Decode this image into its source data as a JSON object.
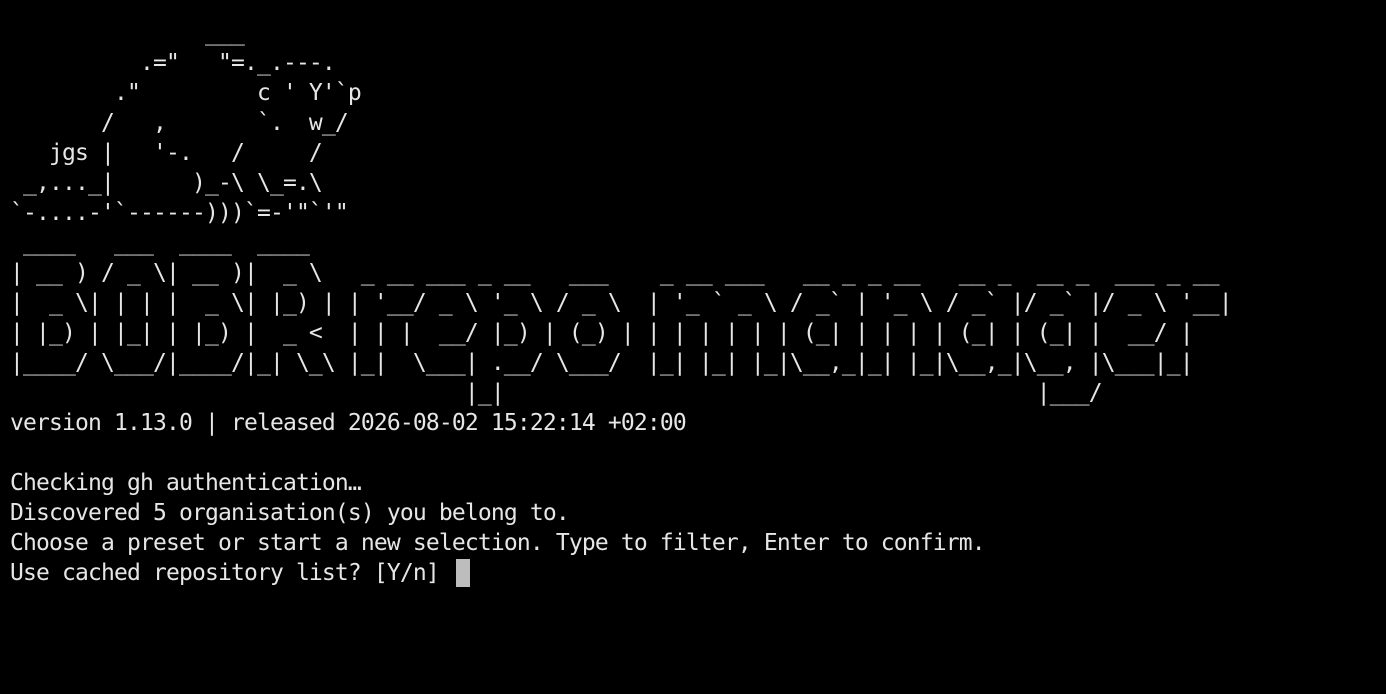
{
  "terminal": {
    "ascii_art": "               ___\n          .=\"   \"=._.---.\n        .\"         c ' Y'`p\n       /   ,       `.  w_/\n   jgs |   '-.   /     /\n _,..._|      )_-\\ \\_=.\\\n`-....-'`------)))`=-'\"`'\"",
    "banner": " ____   ___  ____  ____\n| __ ) / _ \\| __ )|  _ \\   _ __ ___ _ __   ___    _ __ ___   __ _ _ __   __ _  __ _  ___ _ __\n|  _ \\| | | |  _ \\| |_) | | '__/ _ \\ '_ \\ / _ \\  | '_ ` _ \\ / _` | '_ \\ / _` |/ _` |/ _ \\ '__|\n| |_) | |_| | |_) |  _ <  | | |  __/ |_) | (_) | | | | | | | (_| | | | | (_| | (_| |  __/ |\n|____/ \\___/|____/|_| \\_\\ |_|  \\___| .__/ \\___/  |_| |_| |_|\\__,_|_| |_|\\__,_|\\__, |\\___|_|\n                                   |_|                                         |___/",
    "version_line": "version 1.13.0 | released 2026-08-02 15:22:14 +02:00",
    "messages": [
      "Checking gh authentication…",
      "Discovered 5 organisation(s) you belong to.",
      "Choose a preset or start a new selection. Type to filter, Enter to confirm."
    ],
    "prompt": "Use cached repository list? [Y/n] "
  }
}
